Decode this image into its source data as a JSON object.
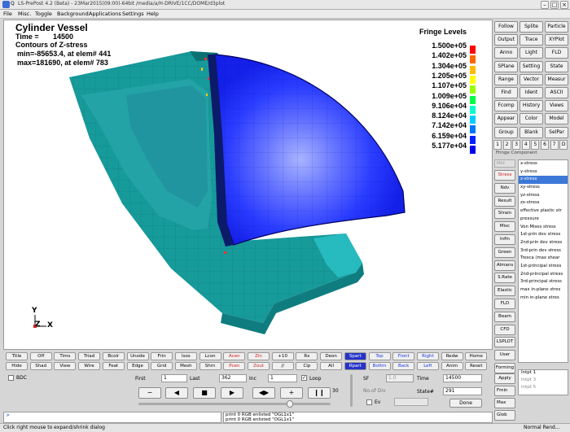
{
  "window": {
    "title": "LS-PrePost 4.2 (Beta) - 23Mar2015(09:00)-64bit /media/a/H-DRIVE/1CC/DOME/d3plot"
  },
  "menu": [
    "File",
    "Misc.",
    "Toggle",
    "Background",
    "Applications",
    "Settings",
    "Help"
  ],
  "viewport": {
    "title": "Cylinder Vessel",
    "time_label": "Time =",
    "time_value": "14500",
    "contour_label": "Contours of Z-stress",
    "min_text": "min=-85653.4, at elem# 441",
    "max_text": "max=181690, at elem# 783",
    "axis_y": "Y",
    "axis_z": "Z",
    "axis_x": "X"
  },
  "fringe": {
    "title": "Fringe Levels",
    "labels": [
      "1.500e+05",
      "1.402e+05",
      "1.304e+05",
      "1.205e+05",
      "1.107e+05",
      "1.009e+05",
      "9.106e+04",
      "8.124e+04",
      "7.142e+04",
      "6.159e+04",
      "5.177e+04"
    ],
    "colors": [
      "#ff0000",
      "#ff6600",
      "#ffbb00",
      "#ffff00",
      "#99ff00",
      "#00ff44",
      "#00ffcc",
      "#00ccff",
      "#0077ff",
      "#0022ff",
      "#0000ee"
    ]
  },
  "right_panel": {
    "buttons": [
      [
        "Follow",
        "Splite",
        "Particle"
      ],
      [
        "Output",
        "Trace",
        "XYPlot"
      ],
      [
        "Anno",
        "Light",
        "FLD"
      ],
      [
        "SPlane",
        "Setting",
        "State"
      ],
      [
        "Range",
        "Vector",
        "Measur"
      ],
      [
        "Find",
        "Ident",
        "ASCII"
      ],
      [
        "Fcomp",
        "History",
        "Views"
      ],
      [
        "Appear",
        "Color",
        "Model"
      ],
      [
        "Group",
        "Blank",
        "SelPar"
      ]
    ],
    "tabs": [
      "1",
      "2",
      "3",
      "4",
      "5",
      "6",
      "7",
      "D"
    ],
    "fringe_component_label": "Fringe Component",
    "side_buttons": [
      "Stress",
      "Ndv",
      "Result",
      "Strain",
      "Misc",
      "Infin",
      "Green",
      "Almans",
      "S.Rate",
      "Elastic",
      "FLD",
      "Beam",
      "CFD",
      "LSPLOT",
      "User",
      "Forming"
    ],
    "mid_label": "Mid",
    "components": [
      "x-stress",
      "y-stress",
      "z-stress",
      "xy-stress",
      "yz-stress",
      "zx-stress",
      "effective plastic str",
      "pressure",
      "Von Mises stress",
      "1st-prin dev stress",
      "2nd-prin dev stress",
      "3rd-prin dev stress",
      "Tresca (max shear",
      "1st-principal stress",
      "2nd-principal stress",
      "3rd-principal stress",
      "max in-plane stres",
      "min in-plane stres"
    ],
    "selected_component": "z-stress",
    "apply_label": "Apply",
    "fmin_label": "Fmin",
    "max_label": "Max",
    "glob_label": "Glob",
    "intpt": [
      "Intpt  1",
      "Intpt  3",
      "Intpt  5"
    ]
  },
  "toolbar": {
    "row1": [
      "Title",
      "Off",
      "Tims",
      "Triad",
      "Bcolr",
      "Unode",
      "Frin",
      "Isos",
      "Lcon",
      "Acen",
      "Zin",
      "+10",
      "Rx",
      "Deon",
      "Spart",
      "Top",
      "Front",
      "Right",
      "Redw",
      "Home"
    ],
    "row2": [
      "Hide",
      "Shad",
      "View",
      "Wire",
      "Feat",
      "Edge",
      "Grid",
      "Mesh",
      "Shrn",
      "Pcen",
      "Zout",
      "//",
      "Clp",
      "All",
      "Rpart",
      "Bottm",
      "Back",
      "Left",
      "Anim",
      "Reset"
    ]
  },
  "animation": {
    "bdc_label": "BDC",
    "first_label": "First",
    "first_value": "1",
    "last_label": "Last",
    "last_value": "362",
    "inc_label": "Inc",
    "inc_value": "1",
    "loop_label": "Loop",
    "speed_value": "30",
    "sf_label": "SF",
    "sf_value": "1.0",
    "noofdiv_label": "No.of Div",
    "ev_label": "Ev",
    "time_label": "Time",
    "time_value": "14500",
    "state_label": "State#",
    "state_value": "291",
    "done_label": "Done",
    "progress": 0.8
  },
  "console": {
    "prompt": ">",
    "lines": [
      "print 0 RGB enlisted \"OGL1x1\"",
      "print 0 RGB enlisted \"OGL1x1\""
    ]
  },
  "status": {
    "left": "Click right mouse to expand/shrink dialog",
    "right": "Normal Rend..."
  }
}
